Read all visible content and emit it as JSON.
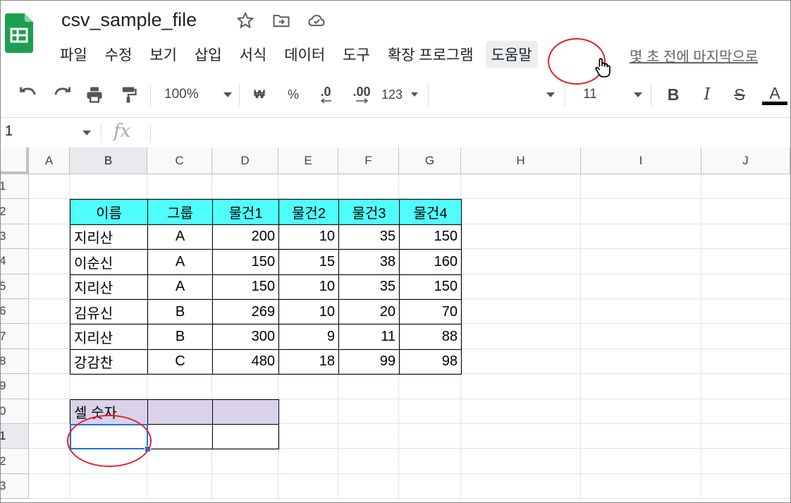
{
  "header": {
    "filename": "csv_sample_file",
    "last_edit": "몇 초 전에 마지막으로"
  },
  "menu": [
    "파일",
    "수정",
    "보기",
    "삽입",
    "서식",
    "데이터",
    "도구",
    "확장 프로그램",
    "도움말"
  ],
  "toolbar": {
    "zoom": "100%",
    "currency": "₩",
    "percent": "%",
    "decrease_decimals": ".0",
    "increase_decimals": ".00",
    "number_format": "123",
    "font_size": "11",
    "bold": "B",
    "italic": "I",
    "strikethrough": "S",
    "text_color": "A",
    "text_color_value": "#000000"
  },
  "formula_bar": {
    "name_box": "1",
    "fx": "fx"
  },
  "columns": [
    "A",
    "B",
    "C",
    "D",
    "E",
    "F",
    "G",
    "H",
    "I",
    "J"
  ],
  "rows": [
    "1",
    "2",
    "3",
    "4",
    "5",
    "6",
    "7",
    "8",
    "9",
    "0",
    "1",
    "2",
    "3"
  ],
  "table": {
    "headers": [
      "이름",
      "그룹",
      "물건1",
      "물건2",
      "물건3",
      "물건4"
    ],
    "rows": [
      [
        "지리산",
        "A",
        "200",
        "10",
        "35",
        "150"
      ],
      [
        "이순신",
        "A",
        "150",
        "15",
        "38",
        "160"
      ],
      [
        "지리산",
        "A",
        "150",
        "10",
        "35",
        "150"
      ],
      [
        "김유신",
        "B",
        "269",
        "10",
        "20",
        "70"
      ],
      [
        "지리산",
        "B",
        "300",
        "9",
        "11",
        "88"
      ],
      [
        "강감찬",
        "C",
        "480",
        "18",
        "99",
        "98"
      ]
    ]
  },
  "summary": {
    "label": "셀 숫자"
  },
  "colors": {
    "header_fill": "#4ffdfd",
    "summary_fill": "#d9d2e9",
    "selection": "#1a73e8",
    "annotation": "#e5202a"
  }
}
